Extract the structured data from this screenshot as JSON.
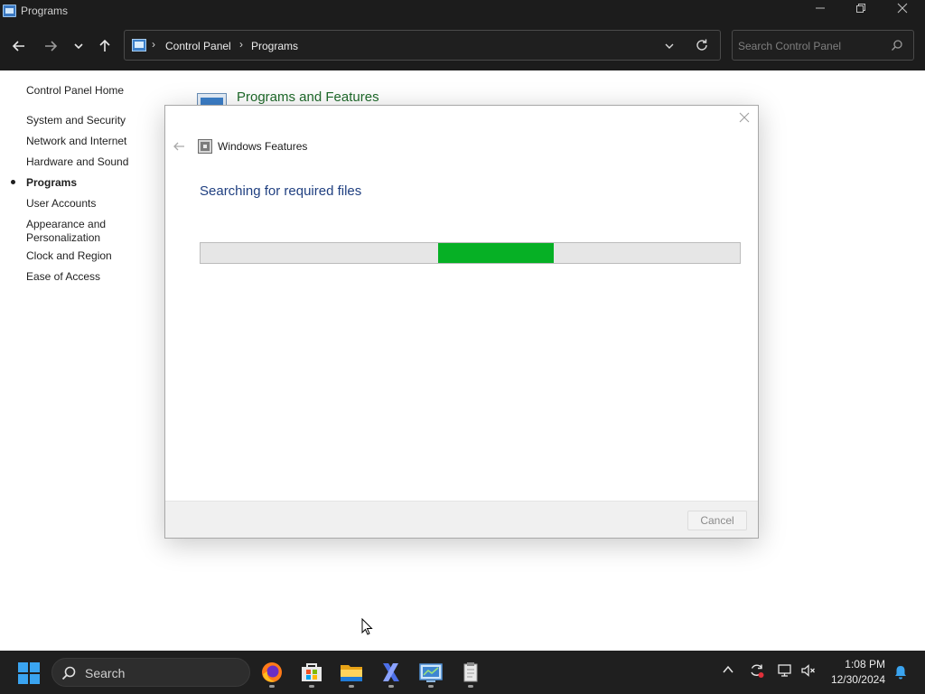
{
  "window": {
    "title": "Programs",
    "minimize_icon": "minimize-icon",
    "maximize_icon": "restore-icon",
    "close_icon": "close-icon"
  },
  "navigation": {
    "breadcrumbs": [
      "Control Panel",
      "Programs"
    ],
    "search_placeholder": "Search Control Panel"
  },
  "sidebar": {
    "items": [
      {
        "label": "Control Panel Home",
        "active": false
      },
      {
        "label": "System and Security",
        "active": false
      },
      {
        "label": "Network and Internet",
        "active": false
      },
      {
        "label": "Hardware and Sound",
        "active": false
      },
      {
        "label": "Programs",
        "active": true
      },
      {
        "label": "User Accounts",
        "active": false
      },
      {
        "label": "Appearance and",
        "active": false
      },
      {
        "label": "Personalization",
        "active": false
      },
      {
        "label": "Clock and Region",
        "active": false
      },
      {
        "label": "Ease of Access",
        "active": false
      }
    ]
  },
  "main": {
    "section_title": "Programs and Features"
  },
  "dialog": {
    "title": "Windows Features",
    "heading": "Searching for required files",
    "progress": {
      "indeterminate": true,
      "segment_start": 0.44,
      "segment_end": 0.655
    },
    "cancel_label": "Cancel"
  },
  "taskbar": {
    "search_label": "Search",
    "apps": [
      "firefox-icon",
      "microsoft-store-icon",
      "file-explorer-icon",
      "x-app-icon",
      "control-panel-icon",
      "notepad-icon"
    ],
    "time": "1:08 PM",
    "date": "12/30/2024"
  },
  "colors": {
    "progress_fill": "#06b025",
    "dialog_heading": "#1f3f80",
    "section_title": "#1e6a2a",
    "chrome_dark": "#1c1c1c"
  }
}
